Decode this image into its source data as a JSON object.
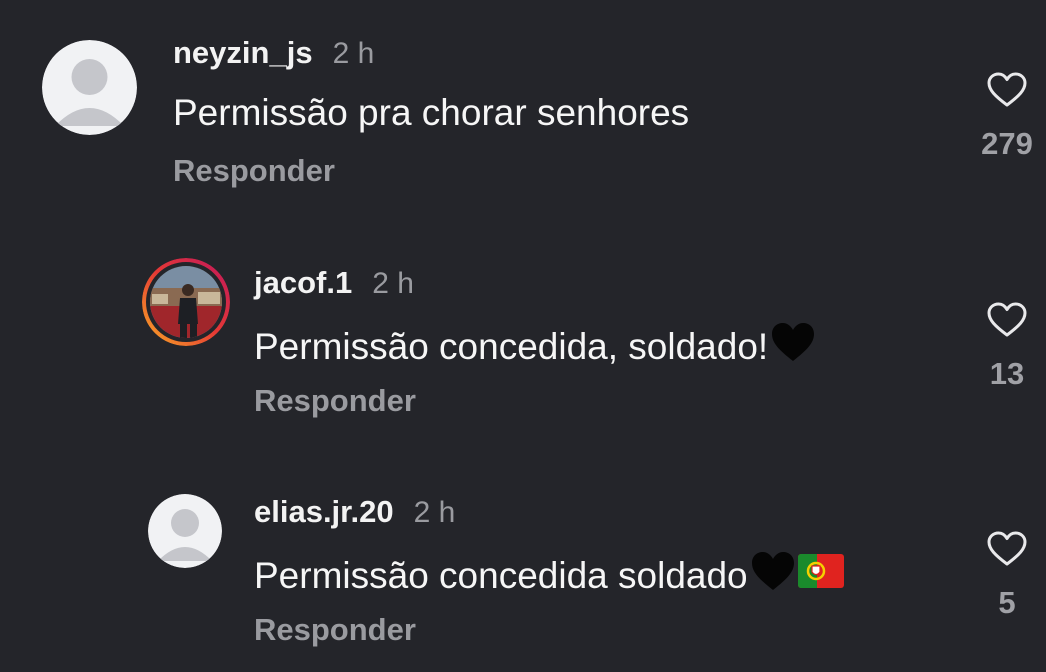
{
  "comments": [
    {
      "username": "neyzin_js",
      "time": "2 h",
      "text": "Permissão pra chorar senhores",
      "reply_label": "Responder",
      "likes": "279",
      "avatar": "default-avatar-icon",
      "emojis": []
    },
    {
      "username": "jacof.1",
      "time": "2 h",
      "text": "Permissão concedida, soldado!",
      "reply_label": "Responder",
      "likes": "13",
      "avatar": "profile-photo-with-story-ring",
      "emojis": [
        "black-heart-emoji"
      ]
    },
    {
      "username": "elias.jr.20",
      "time": "2 h",
      "text": "Permissão concedida soldado",
      "reply_label": "Responder",
      "likes": "5",
      "avatar": "default-avatar-icon",
      "emojis": [
        "black-heart-emoji",
        "portugal-flag-emoji"
      ]
    }
  ],
  "colors": {
    "background": "#24252a",
    "text": "#f6f6f6",
    "muted": "#9a9ba0",
    "story_ring_start": "#f9a825",
    "story_ring_end": "#c2185b"
  }
}
